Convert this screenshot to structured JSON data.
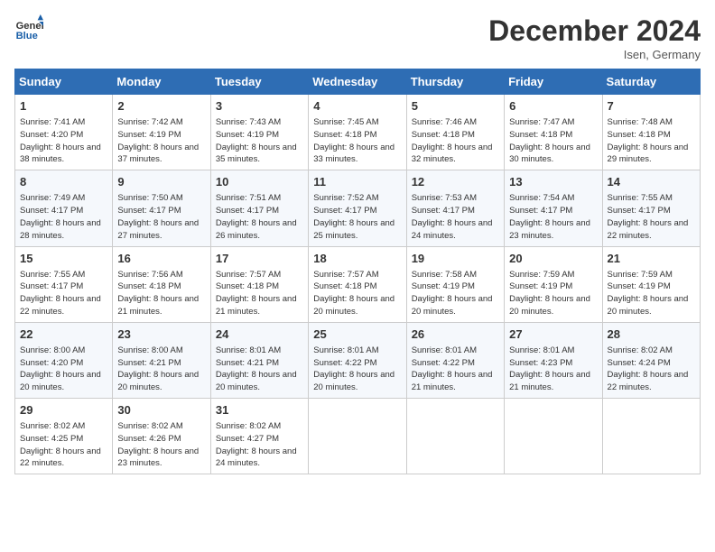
{
  "header": {
    "logo_line1": "General",
    "logo_line2": "Blue",
    "month": "December 2024",
    "location": "Isen, Germany"
  },
  "columns": [
    "Sunday",
    "Monday",
    "Tuesday",
    "Wednesday",
    "Thursday",
    "Friday",
    "Saturday"
  ],
  "weeks": [
    [
      {
        "day": "1",
        "sunrise": "7:41 AM",
        "sunset": "4:20 PM",
        "daylight": "8 hours and 38 minutes."
      },
      {
        "day": "2",
        "sunrise": "7:42 AM",
        "sunset": "4:19 PM",
        "daylight": "8 hours and 37 minutes."
      },
      {
        "day": "3",
        "sunrise": "7:43 AM",
        "sunset": "4:19 PM",
        "daylight": "8 hours and 35 minutes."
      },
      {
        "day": "4",
        "sunrise": "7:45 AM",
        "sunset": "4:18 PM",
        "daylight": "8 hours and 33 minutes."
      },
      {
        "day": "5",
        "sunrise": "7:46 AM",
        "sunset": "4:18 PM",
        "daylight": "8 hours and 32 minutes."
      },
      {
        "day": "6",
        "sunrise": "7:47 AM",
        "sunset": "4:18 PM",
        "daylight": "8 hours and 30 minutes."
      },
      {
        "day": "7",
        "sunrise": "7:48 AM",
        "sunset": "4:18 PM",
        "daylight": "8 hours and 29 minutes."
      }
    ],
    [
      {
        "day": "8",
        "sunrise": "7:49 AM",
        "sunset": "4:17 PM",
        "daylight": "8 hours and 28 minutes."
      },
      {
        "day": "9",
        "sunrise": "7:50 AM",
        "sunset": "4:17 PM",
        "daylight": "8 hours and 27 minutes."
      },
      {
        "day": "10",
        "sunrise": "7:51 AM",
        "sunset": "4:17 PM",
        "daylight": "8 hours and 26 minutes."
      },
      {
        "day": "11",
        "sunrise": "7:52 AM",
        "sunset": "4:17 PM",
        "daylight": "8 hours and 25 minutes."
      },
      {
        "day": "12",
        "sunrise": "7:53 AM",
        "sunset": "4:17 PM",
        "daylight": "8 hours and 24 minutes."
      },
      {
        "day": "13",
        "sunrise": "7:54 AM",
        "sunset": "4:17 PM",
        "daylight": "8 hours and 23 minutes."
      },
      {
        "day": "14",
        "sunrise": "7:55 AM",
        "sunset": "4:17 PM",
        "daylight": "8 hours and 22 minutes."
      }
    ],
    [
      {
        "day": "15",
        "sunrise": "7:55 AM",
        "sunset": "4:17 PM",
        "daylight": "8 hours and 22 minutes."
      },
      {
        "day": "16",
        "sunrise": "7:56 AM",
        "sunset": "4:18 PM",
        "daylight": "8 hours and 21 minutes."
      },
      {
        "day": "17",
        "sunrise": "7:57 AM",
        "sunset": "4:18 PM",
        "daylight": "8 hours and 21 minutes."
      },
      {
        "day": "18",
        "sunrise": "7:57 AM",
        "sunset": "4:18 PM",
        "daylight": "8 hours and 20 minutes."
      },
      {
        "day": "19",
        "sunrise": "7:58 AM",
        "sunset": "4:19 PM",
        "daylight": "8 hours and 20 minutes."
      },
      {
        "day": "20",
        "sunrise": "7:59 AM",
        "sunset": "4:19 PM",
        "daylight": "8 hours and 20 minutes."
      },
      {
        "day": "21",
        "sunrise": "7:59 AM",
        "sunset": "4:19 PM",
        "daylight": "8 hours and 20 minutes."
      }
    ],
    [
      {
        "day": "22",
        "sunrise": "8:00 AM",
        "sunset": "4:20 PM",
        "daylight": "8 hours and 20 minutes."
      },
      {
        "day": "23",
        "sunrise": "8:00 AM",
        "sunset": "4:21 PM",
        "daylight": "8 hours and 20 minutes."
      },
      {
        "day": "24",
        "sunrise": "8:01 AM",
        "sunset": "4:21 PM",
        "daylight": "8 hours and 20 minutes."
      },
      {
        "day": "25",
        "sunrise": "8:01 AM",
        "sunset": "4:22 PM",
        "daylight": "8 hours and 20 minutes."
      },
      {
        "day": "26",
        "sunrise": "8:01 AM",
        "sunset": "4:22 PM",
        "daylight": "8 hours and 21 minutes."
      },
      {
        "day": "27",
        "sunrise": "8:01 AM",
        "sunset": "4:23 PM",
        "daylight": "8 hours and 21 minutes."
      },
      {
        "day": "28",
        "sunrise": "8:02 AM",
        "sunset": "4:24 PM",
        "daylight": "8 hours and 22 minutes."
      }
    ],
    [
      {
        "day": "29",
        "sunrise": "8:02 AM",
        "sunset": "4:25 PM",
        "daylight": "8 hours and 22 minutes."
      },
      {
        "day": "30",
        "sunrise": "8:02 AM",
        "sunset": "4:26 PM",
        "daylight": "8 hours and 23 minutes."
      },
      {
        "day": "31",
        "sunrise": "8:02 AM",
        "sunset": "4:27 PM",
        "daylight": "8 hours and 24 minutes."
      },
      null,
      null,
      null,
      null
    ]
  ]
}
